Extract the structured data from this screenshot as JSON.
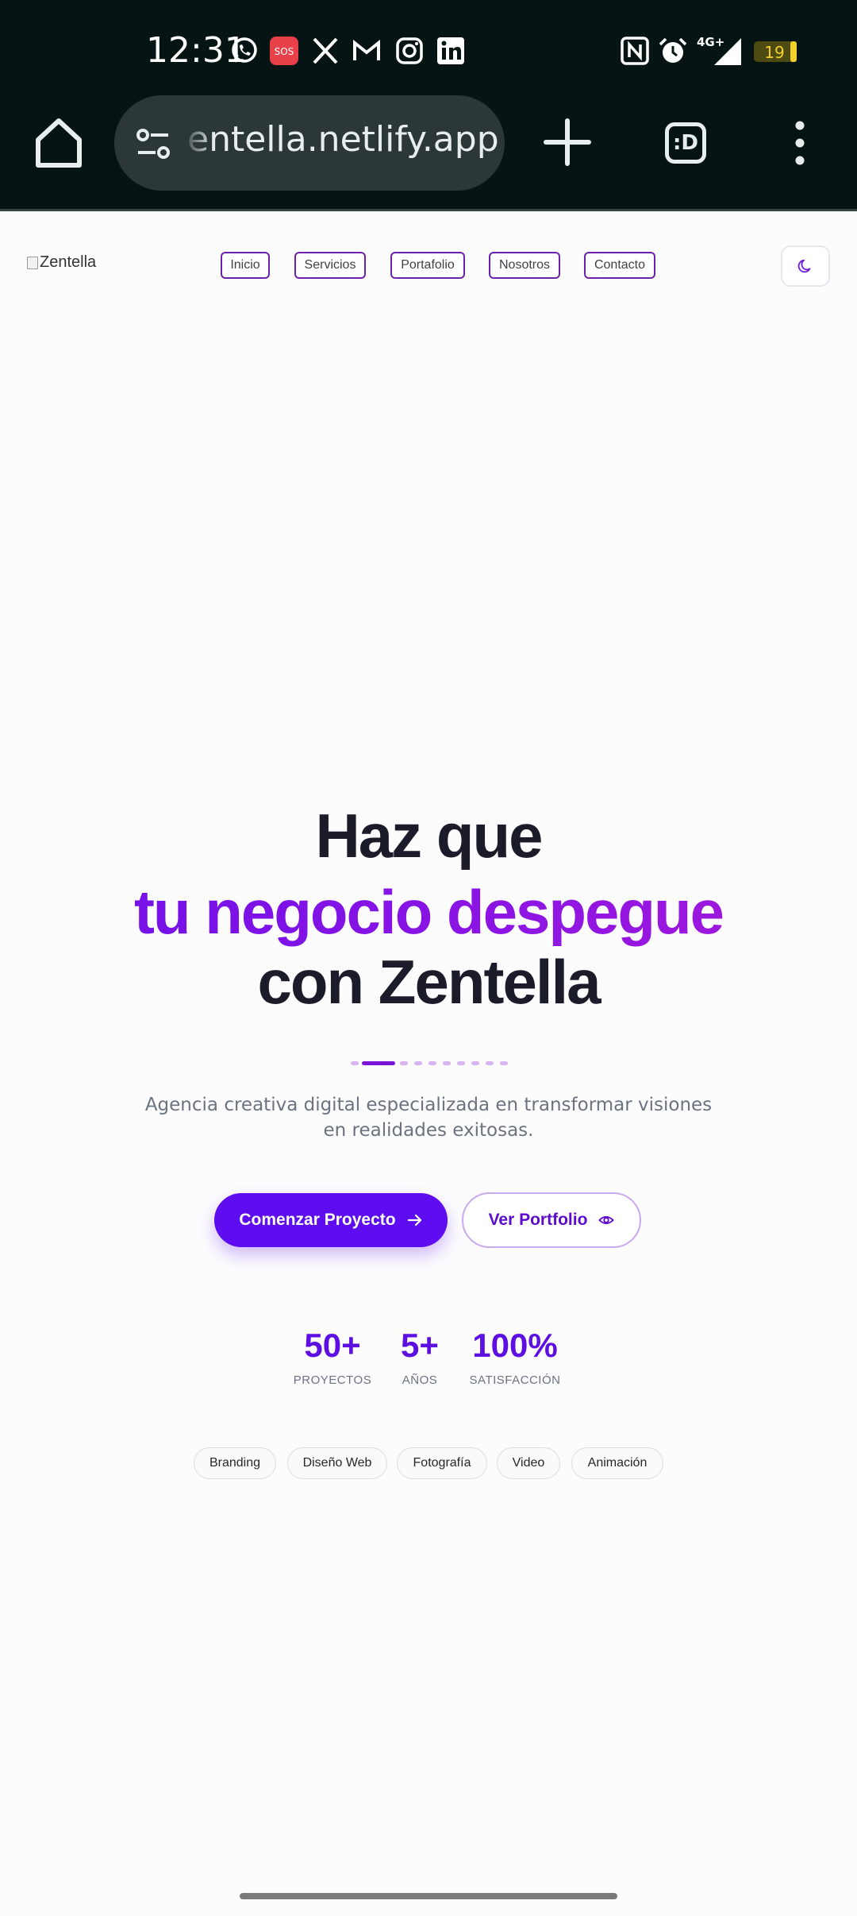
{
  "status_bar": {
    "time": "12:31",
    "battery": "19",
    "network": "4G+",
    "left_icons": [
      "whatsapp-icon",
      "sos-icon",
      "x-icon",
      "gmail-icon",
      "instagram-icon",
      "linkedin-icon"
    ],
    "right_icons": [
      "nfc-icon",
      "alarm-icon",
      "signal-icon",
      "battery-icon"
    ],
    "sos_label": "SOS"
  },
  "browser": {
    "url": "entella.netlify.app",
    "tabs_label": ":D"
  },
  "header": {
    "logo_alt": "Zentella",
    "nav": [
      "Inicio",
      "Servicios",
      "Portafolio",
      "Nosotros",
      "Contacto"
    ]
  },
  "hero": {
    "line1": "Haz que",
    "line2": "tu negocio despegue",
    "line3": "con Zentella",
    "subtitle": "Agencia creativa digital especializada en transformar visiones en realidades exitosas.",
    "primary_cta": "Comenzar Proyecto",
    "secondary_cta": "Ver Portfolio"
  },
  "stats": [
    {
      "value": "50+",
      "label": "PROYECTOS"
    },
    {
      "value": "5+",
      "label": "AÑOS"
    },
    {
      "value": "100%",
      "label": "SATISFACCIÓN"
    }
  ],
  "tags": [
    "Branding",
    "Diseño Web",
    "Fotografía",
    "Video",
    "Animación"
  ],
  "colors": {
    "chrome_bg": "#061414",
    "accent": "#5e0cf0",
    "gradient_start": "#6d10e8",
    "gradient_end": "#a51ad9",
    "heading": "#1c1b29"
  }
}
